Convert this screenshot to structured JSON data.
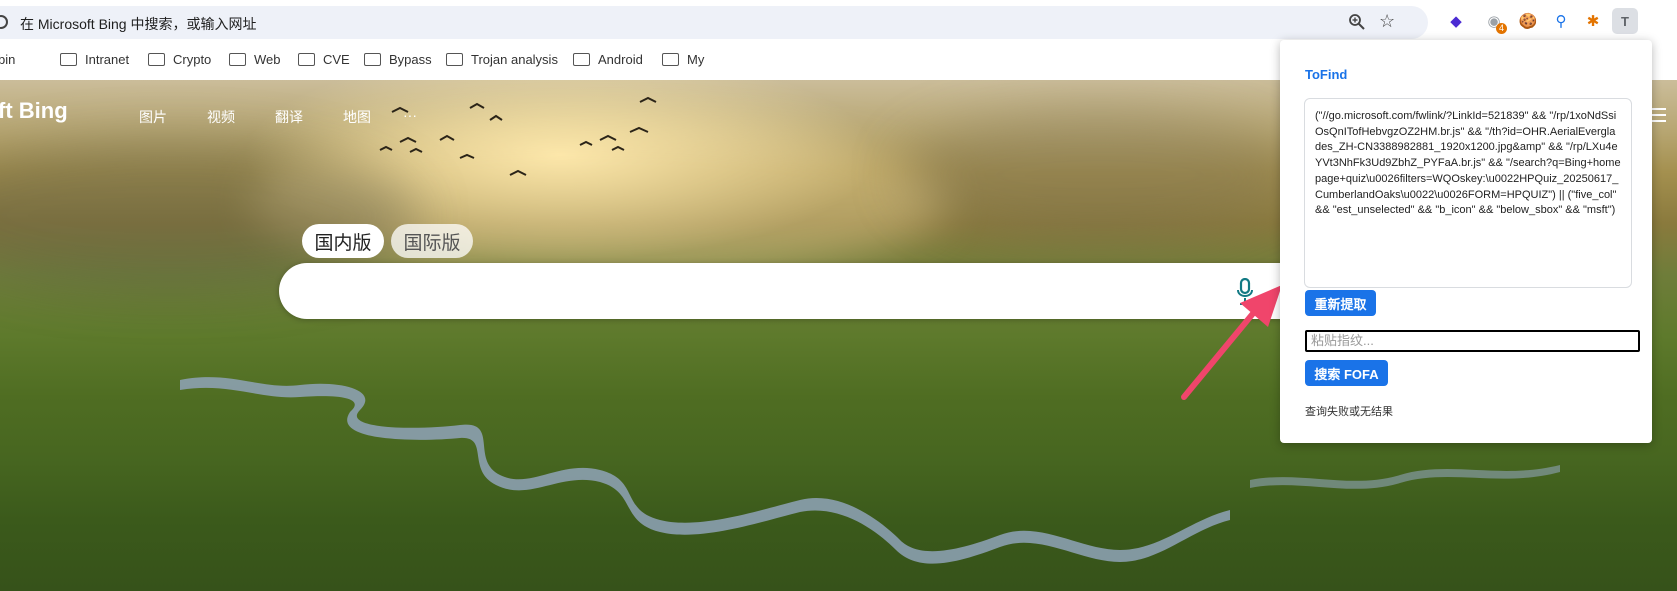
{
  "browser": {
    "omnibox_placeholder": "在 Microsoft Bing 中搜索，或输入网址",
    "zoom_icon": "zoom-icon",
    "star_icon": "bookmark-star-icon",
    "extensions": [
      {
        "name": "purple-cube-extension-icon",
        "glyph": "◆",
        "color": "#4b2bd3"
      },
      {
        "name": "gray-extension-icon",
        "glyph": "◉",
        "color": "#9aa0a6",
        "badge": "4"
      },
      {
        "name": "cookie-extension-icon",
        "glyph": "🍪",
        "color": "#8b5a2b"
      },
      {
        "name": "pin-extension-icon",
        "glyph": "⚲",
        "color": "#1a73e8"
      },
      {
        "name": "puzzle-extension-icon",
        "glyph": "✱",
        "color": "#e37400"
      },
      {
        "name": "tofind-extension-icon",
        "glyph": "T",
        "color": "#5f6368"
      }
    ]
  },
  "bookmarks": [
    {
      "label": "bin",
      "folder": false
    },
    {
      "label": "Intranet",
      "folder": true
    },
    {
      "label": "Crypto",
      "folder": true
    },
    {
      "label": "Web",
      "folder": true
    },
    {
      "label": "CVE",
      "folder": true
    },
    {
      "label": "Bypass",
      "folder": true
    },
    {
      "label": "Trojan analysis",
      "folder": true
    },
    {
      "label": "Android",
      "folder": true
    },
    {
      "label": "My",
      "folder": true
    }
  ],
  "bing": {
    "brand": "ft Bing",
    "nav": [
      "图片",
      "视频",
      "翻译",
      "地图",
      "···"
    ],
    "tabs": [
      {
        "label": "国内版",
        "active": true
      },
      {
        "label": "国际版",
        "active": false
      }
    ],
    "search_value": "",
    "mic_icon": "microphone-icon",
    "menu_icon": "hamburger-menu-icon"
  },
  "popup": {
    "title": "ToFind",
    "fingerprint": "(\"//go.microsoft.com/fwlink/?LinkId=521839\" && \"/rp/1xoNdSsiOsQnITofHebvgzOZ2HM.br.js\" && \"/th?id=OHR.AerialEverglades_ZH-CN3388982881_1920x1200.jpg&amp\" && \"/rp/LXu4eYVt3NhFk3Ud9ZbhZ_PYFaA.br.js\" && \"/search?q=Bing+homepage+quiz\\u0026filters=WQOskey:\\u0022HPQuiz_20250617_CumberlandOaks\\u0022\\u0026FORM=HPQUIZ\") || (\"five_col\" && \"est_unselected\" && \"b_icon\" && \"below_sbox\" && \"msft\")",
    "refetch_label": "重新提取",
    "paste_placeholder": "粘贴指纹...",
    "search_fofa_label": "搜索 FOFA",
    "status": "查询失败或无结果"
  },
  "colors": {
    "accent": "#1a73e8",
    "omnibox_bg": "#eef1f8",
    "arrow": "#f0456b"
  }
}
